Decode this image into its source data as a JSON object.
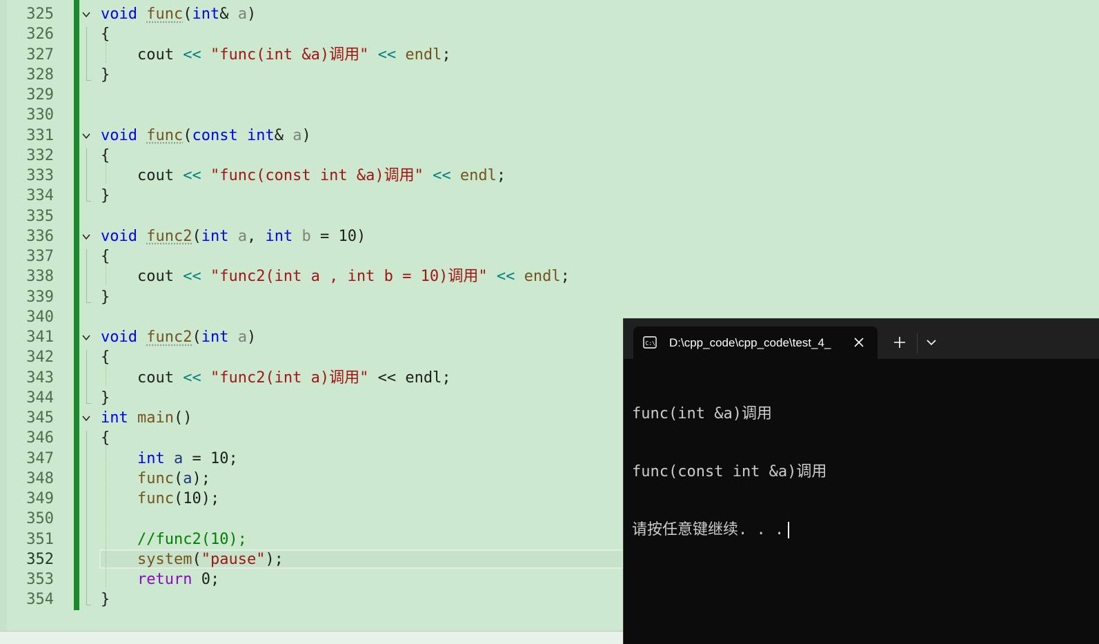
{
  "editor": {
    "active_line": "352",
    "lines": [
      {
        "n": "325",
        "code": [
          {
            "t": "void",
            "c": "kw"
          },
          {
            "t": " "
          },
          {
            "t": "func",
            "c": "fn squig"
          },
          {
            "t": "("
          },
          {
            "t": "int",
            "c": "kw"
          },
          {
            "t": "& "
          },
          {
            "t": "a",
            "c": "prm"
          },
          {
            "t": ")"
          }
        ]
      },
      {
        "n": "326",
        "code": [
          {
            "t": "{"
          }
        ]
      },
      {
        "n": "327",
        "code": [
          {
            "t": "    cout "
          },
          {
            "t": "<<",
            "c": "op"
          },
          {
            "t": " "
          },
          {
            "t": "\"func(int &a)调用\"",
            "c": "str"
          },
          {
            "t": " "
          },
          {
            "t": "<<",
            "c": "op"
          },
          {
            "t": " "
          },
          {
            "t": "endl",
            "c": "fn"
          },
          {
            "t": ";"
          }
        ]
      },
      {
        "n": "328",
        "code": [
          {
            "t": "}"
          }
        ]
      },
      {
        "n": "329",
        "code": []
      },
      {
        "n": "330",
        "code": []
      },
      {
        "n": "331",
        "code": [
          {
            "t": "void",
            "c": "kw"
          },
          {
            "t": " "
          },
          {
            "t": "func",
            "c": "fn squig"
          },
          {
            "t": "("
          },
          {
            "t": "const",
            "c": "kw"
          },
          {
            "t": " "
          },
          {
            "t": "int",
            "c": "kw"
          },
          {
            "t": "& "
          },
          {
            "t": "a",
            "c": "prm"
          },
          {
            "t": ")"
          }
        ]
      },
      {
        "n": "332",
        "code": [
          {
            "t": "{"
          }
        ]
      },
      {
        "n": "333",
        "code": [
          {
            "t": "    cout "
          },
          {
            "t": "<<",
            "c": "op"
          },
          {
            "t": " "
          },
          {
            "t": "\"func(const int &a)调用\"",
            "c": "str"
          },
          {
            "t": " "
          },
          {
            "t": "<<",
            "c": "op"
          },
          {
            "t": " "
          },
          {
            "t": "endl",
            "c": "fn"
          },
          {
            "t": ";"
          }
        ]
      },
      {
        "n": "334",
        "code": [
          {
            "t": "}"
          }
        ]
      },
      {
        "n": "335",
        "code": []
      },
      {
        "n": "336",
        "code": [
          {
            "t": "void",
            "c": "kw"
          },
          {
            "t": " "
          },
          {
            "t": "func2",
            "c": "fn squig"
          },
          {
            "t": "("
          },
          {
            "t": "int",
            "c": "kw"
          },
          {
            "t": " "
          },
          {
            "t": "a",
            "c": "prm"
          },
          {
            "t": ", "
          },
          {
            "t": "int",
            "c": "kw"
          },
          {
            "t": " "
          },
          {
            "t": "b",
            "c": "prm"
          },
          {
            "t": " = 10)"
          }
        ]
      },
      {
        "n": "337",
        "code": [
          {
            "t": "{"
          }
        ]
      },
      {
        "n": "338",
        "code": [
          {
            "t": "    cout "
          },
          {
            "t": "<<",
            "c": "op"
          },
          {
            "t": " "
          },
          {
            "t": "\"func2(int a , int b = 10)调用\"",
            "c": "str"
          },
          {
            "t": " "
          },
          {
            "t": "<<",
            "c": "op"
          },
          {
            "t": " "
          },
          {
            "t": "endl",
            "c": "fn"
          },
          {
            "t": ";"
          }
        ]
      },
      {
        "n": "339",
        "code": [
          {
            "t": "}"
          }
        ]
      },
      {
        "n": "340",
        "code": []
      },
      {
        "n": "341",
        "code": [
          {
            "t": "void",
            "c": "kw"
          },
          {
            "t": " "
          },
          {
            "t": "func2",
            "c": "fn squig"
          },
          {
            "t": "("
          },
          {
            "t": "int",
            "c": "kw"
          },
          {
            "t": " "
          },
          {
            "t": "a",
            "c": "prm"
          },
          {
            "t": ")"
          }
        ]
      },
      {
        "n": "342",
        "code": [
          {
            "t": "{"
          }
        ]
      },
      {
        "n": "343",
        "code": [
          {
            "t": "    cout "
          },
          {
            "t": "<<",
            "c": "op"
          },
          {
            "t": " "
          },
          {
            "t": "\"func2(int a)调用\"",
            "c": "str"
          },
          {
            "t": " << endl;"
          }
        ]
      },
      {
        "n": "344",
        "code": [
          {
            "t": "}"
          }
        ]
      },
      {
        "n": "345",
        "code": [
          {
            "t": "int",
            "c": "kw"
          },
          {
            "t": " "
          },
          {
            "t": "main",
            "c": "fn"
          },
          {
            "t": "()"
          }
        ]
      },
      {
        "n": "346",
        "code": [
          {
            "t": "{"
          }
        ]
      },
      {
        "n": "347",
        "code": [
          {
            "t": "    "
          },
          {
            "t": "int",
            "c": "kw"
          },
          {
            "t": " "
          },
          {
            "t": "a",
            "c": "var"
          },
          {
            "t": " = 10;"
          }
        ]
      },
      {
        "n": "348",
        "code": [
          {
            "t": "    "
          },
          {
            "t": "func",
            "c": "fn"
          },
          {
            "t": "("
          },
          {
            "t": "a",
            "c": "var"
          },
          {
            "t": ");"
          }
        ]
      },
      {
        "n": "349",
        "code": [
          {
            "t": "    "
          },
          {
            "t": "func",
            "c": "fn"
          },
          {
            "t": "(10);"
          }
        ]
      },
      {
        "n": "350",
        "code": []
      },
      {
        "n": "351",
        "code": [
          {
            "t": "    "
          },
          {
            "t": "//func2(10);",
            "c": "cmt"
          }
        ]
      },
      {
        "n": "352",
        "code": [
          {
            "t": "    "
          },
          {
            "t": "system",
            "c": "fn"
          },
          {
            "t": "("
          },
          {
            "t": "\"pause\"",
            "c": "str"
          },
          {
            "t": ");"
          }
        ]
      },
      {
        "n": "353",
        "code": [
          {
            "t": "    "
          },
          {
            "t": "return",
            "c": "ctrl"
          },
          {
            "t": " 0;"
          }
        ]
      },
      {
        "n": "354",
        "code": [
          {
            "t": "}"
          }
        ]
      }
    ]
  },
  "terminal": {
    "tab_title": "D:\\cpp_code\\cpp_code\\test_4_",
    "output": [
      "func(int &a)调用",
      "func(const int &a)调用",
      "请按任意键继续. . ."
    ],
    "icons": {
      "tab": "console-icon",
      "close": "close-icon",
      "new_tab": "plus-icon",
      "dropdown": "chevron-down-icon"
    }
  },
  "colors": {
    "editor_bg": "#cce8cf",
    "change_bar": "#1a8a2a",
    "terminal_bg": "#0c0c0c",
    "terminal_titlebar": "#202020"
  }
}
